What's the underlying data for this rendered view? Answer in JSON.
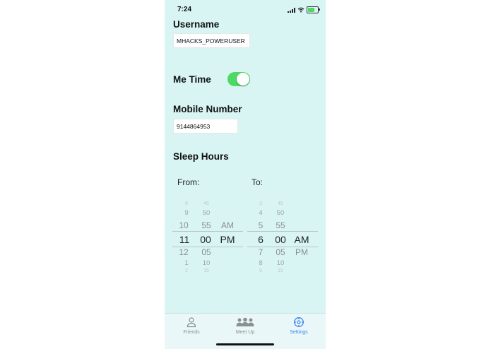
{
  "status": {
    "time": "7:24"
  },
  "username": {
    "label": "Username",
    "value": "MHACKS_POWERUSER"
  },
  "me_time": {
    "label": "Me Time",
    "enabled": true
  },
  "mobile": {
    "label": "Mobile Number",
    "value": "9144864953"
  },
  "sleep": {
    "label": "Sleep Hours",
    "from": {
      "label": "From:",
      "hours": [
        "8",
        "9",
        "10",
        "11",
        "12",
        "1",
        "2"
      ],
      "minutes": [
        "45",
        "50",
        "55",
        "00",
        "05",
        "10",
        "15"
      ],
      "ampm": [
        "AM",
        "PM"
      ],
      "selected": {
        "hour": "11",
        "minute": "00",
        "ampm": "PM"
      }
    },
    "to": {
      "label": "To:",
      "hours": [
        "3",
        "4",
        "5",
        "6",
        "7",
        "8",
        "9"
      ],
      "minutes": [
        "45",
        "50",
        "55",
        "00",
        "05",
        "10",
        "15"
      ],
      "ampm": [
        "AM",
        "PM"
      ],
      "selected": {
        "hour": "6",
        "minute": "00",
        "ampm": "AM"
      }
    }
  },
  "tabs": [
    {
      "label": "Friends",
      "icon": "person-icon",
      "active": false
    },
    {
      "label": "Meet Up",
      "icon": "group-icon",
      "active": false
    },
    {
      "label": "Settings",
      "icon": "settings-icon",
      "active": true
    }
  ],
  "colors": {
    "background": "#d8f5f4",
    "toggle_on": "#4cd964",
    "accent": "#3b82f6"
  }
}
